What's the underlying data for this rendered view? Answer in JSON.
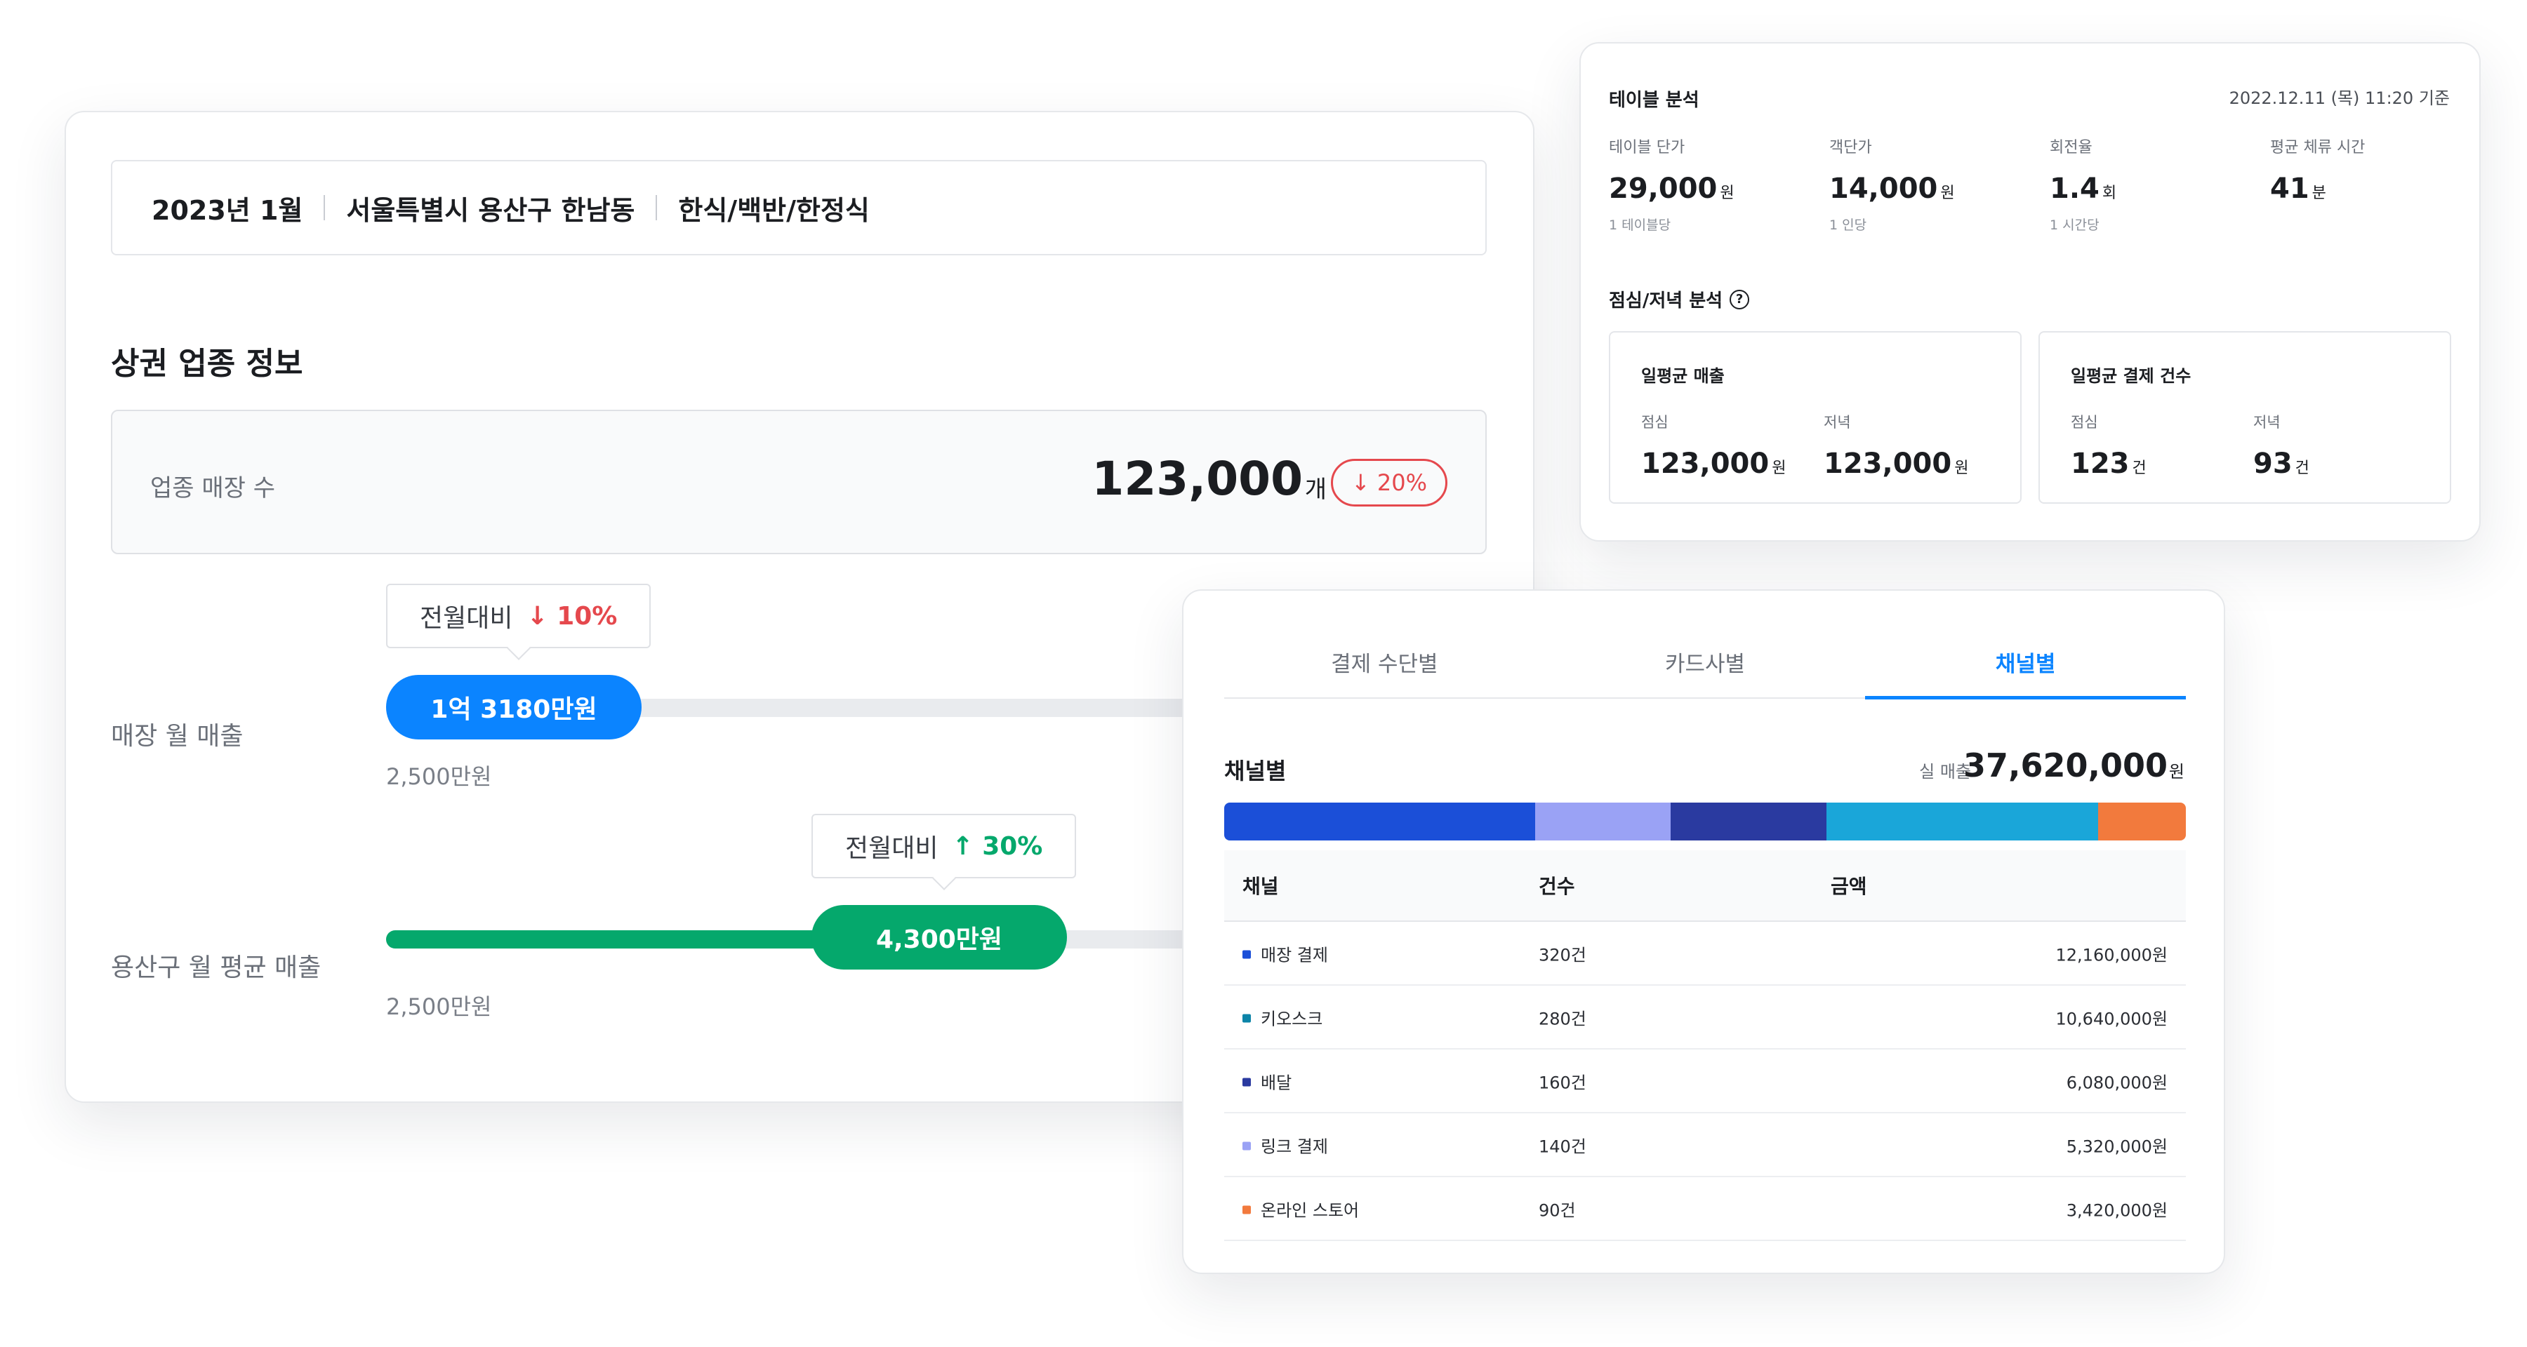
{
  "filter": {
    "month": "2023년 1월",
    "region": "서울특별시 용산구 한남동",
    "category": "한식/백반/한정식"
  },
  "business_info": {
    "title": "상권 업종 정보",
    "store_count": {
      "label": "업종 매장 수",
      "value": "123,000",
      "unit": "개",
      "change": "20%",
      "change_direction": "down",
      "arrow": "↓"
    },
    "store_monthly_sales": {
      "label": "매장 월 매출",
      "value": "1억 3180만원",
      "min_label": "2,500만원",
      "compare_label": "전월대비",
      "compare_value": "10%",
      "compare_direction": "down",
      "arrow": "↓",
      "level_percent": 23
    },
    "district_avg_sales": {
      "label": "용산구 월 평균 매출",
      "value": "4,300만원",
      "min_label": "2,500만원",
      "compare_label": "전월대비",
      "compare_value": "30%",
      "compare_direction": "up",
      "arrow": "↑",
      "level_percent": 62
    }
  },
  "table_analysis": {
    "title": "테이블 분석",
    "timestamp": "2022.12.11 (목) 11:20 기준",
    "metrics": [
      {
        "label": "테이블 단가",
        "value": "29,000",
        "unit": "원",
        "sub": "1 테이블당"
      },
      {
        "label": "객단가",
        "value": "14,000",
        "unit": "원",
        "sub": "1 인당"
      },
      {
        "label": "회전율",
        "value": "1.4",
        "unit": "회",
        "sub": "1 시간당"
      },
      {
        "label": "평균 체류 시간",
        "value": "41",
        "unit": "분",
        "sub": ""
      }
    ],
    "lunch_dinner": {
      "title": "점심/저녁 분석",
      "help_icon": "?",
      "boxes": [
        {
          "title": "일평균 매출",
          "lunch_label": "점심",
          "lunch_value": "123,000",
          "lunch_unit": "원",
          "dinner_label": "저녁",
          "dinner_value": "123,000",
          "dinner_unit": "원"
        },
        {
          "title": "일평균 결제 건수",
          "lunch_label": "점심",
          "lunch_value": "123",
          "lunch_unit": "건",
          "dinner_label": "저녁",
          "dinner_value": "93",
          "dinner_unit": "건"
        }
      ]
    }
  },
  "channel": {
    "tabs": [
      {
        "label": "결제 수단별",
        "active": false
      },
      {
        "label": "카드사별",
        "active": false
      },
      {
        "label": "채널별",
        "active": true
      }
    ],
    "title": "채널별",
    "total_label": "실 매출",
    "total_value": "37,620,000",
    "total_unit": "원",
    "headers": {
      "channel": "채널",
      "count": "건수",
      "amount": "금액"
    },
    "rows": [
      {
        "name": "매장 결제",
        "count": "320건",
        "amount": "12,160,000원",
        "color": "#1b4fd8"
      },
      {
        "name": "키오스크",
        "count": "280건",
        "amount": "10,640,000원",
        "color": "#0c84a8"
      },
      {
        "name": "배달",
        "count": "160건",
        "amount": "6,080,000원",
        "color": "#2a3aa0"
      },
      {
        "name": "링크 결제",
        "count": "140건",
        "amount": "5,320,000원",
        "color": "#9aa2f5"
      },
      {
        "name": "온라인 스토어",
        "count": "90건",
        "amount": "3,420,000원",
        "color": "#f27a3d"
      }
    ],
    "stack_segments": [
      {
        "color": "#1b4fd8",
        "share": 32.3
      },
      {
        "color": "#9aa2f5",
        "share": 14.1
      },
      {
        "color": "#2a3aa0",
        "share": 16.2
      },
      {
        "color": "#1aa6d9",
        "share": 28.3
      },
      {
        "color": "#f27a3d",
        "share": 9.1
      }
    ]
  }
}
